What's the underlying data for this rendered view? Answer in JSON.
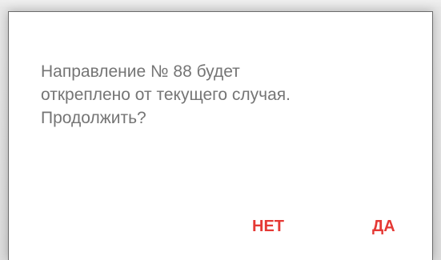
{
  "dialog": {
    "message_lines": [
      "Направление № 88 будет",
      "откреплено от текущего случая.",
      "Продолжить?"
    ],
    "buttons": {
      "no_label": "НЕТ",
      "yes_label": "ДА"
    }
  },
  "colors": {
    "accent": "#e53935",
    "message_text": "#757575",
    "dialog_bg": "#ffffff"
  }
}
